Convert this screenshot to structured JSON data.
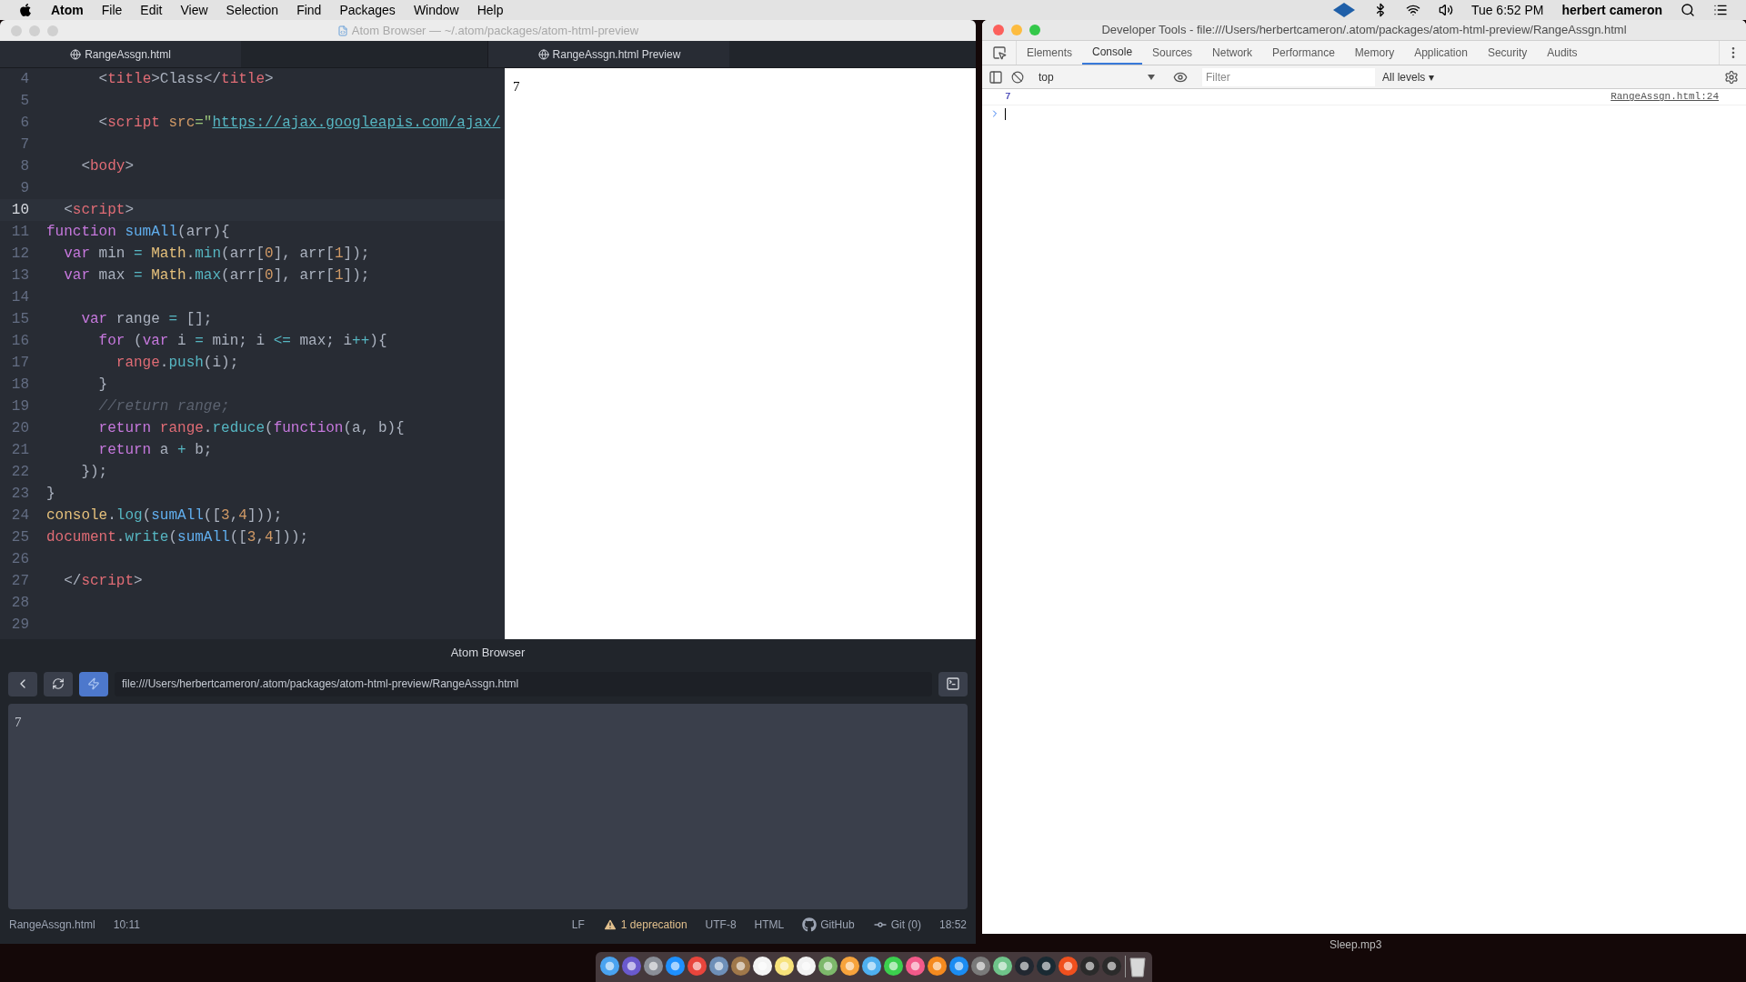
{
  "menu_bar": {
    "app": "Atom",
    "items": [
      "File",
      "Edit",
      "View",
      "Selection",
      "Find",
      "Packages",
      "Window",
      "Help"
    ],
    "clock": "Tue 6:52 PM",
    "user": "herbert cameron"
  },
  "atom_window": {
    "title": "Atom Browser — ~/.atom/packages/atom-html-preview",
    "tabs": [
      {
        "label": "RangeAssgn.html",
        "selected": true
      },
      {
        "label": "RangeAssgn.html Preview",
        "selected": true
      }
    ],
    "editor": {
      "lines": [
        {
          "number": "4",
          "current": false,
          "tokens": [
            {
              "text": "      <",
              "kind": "p"
            },
            {
              "text": "title",
              "kind": "tag"
            },
            {
              "text": ">Class</",
              "kind": "p"
            },
            {
              "text": "title",
              "kind": "tag"
            },
            {
              "text": ">",
              "kind": "p"
            }
          ]
        },
        {
          "number": "5",
          "current": false
        },
        {
          "number": "6",
          "current": false,
          "tokens": [
            {
              "text": "      <",
              "kind": "p"
            },
            {
              "text": "script",
              "kind": "tag"
            },
            {
              "text": " src",
              "kind": "attr"
            },
            {
              "text": "=\"",
              "kind": "str"
            },
            {
              "text": "https://ajax.googleapis.com/ajax/",
              "kind": "link"
            }
          ]
        },
        {
          "number": "7",
          "current": false
        },
        {
          "number": "8",
          "current": false,
          "tokens": [
            {
              "text": "    <",
              "kind": "p"
            },
            {
              "text": "body",
              "kind": "tag"
            },
            {
              "text": ">",
              "kind": "p"
            }
          ]
        },
        {
          "number": "9",
          "current": false
        },
        {
          "number": "10",
          "current": true,
          "tokens": [
            {
              "text": "  <",
              "kind": "p"
            },
            {
              "text": "script",
              "kind": "tag"
            },
            {
              "text": ">",
              "kind": "p"
            }
          ]
        },
        {
          "number": "11",
          "current": false,
          "tokens": [
            {
              "text": "function",
              "kind": "kw"
            },
            {
              "text": " sumAll",
              "kind": "fn"
            },
            {
              "text": "(arr){",
              "kind": "p"
            }
          ]
        },
        {
          "number": "12",
          "current": false,
          "tokens": [
            {
              "text": "  var",
              "kind": "kw"
            },
            {
              "text": " min ",
              "kind": "p"
            },
            {
              "text": "=",
              "kind": "op"
            },
            {
              "text": " Math",
              "kind": "obj"
            },
            {
              "text": ".",
              "kind": "p"
            },
            {
              "text": "min",
              "kind": "method"
            },
            {
              "text": "(arr[",
              "kind": "p"
            },
            {
              "text": "0",
              "kind": "num"
            },
            {
              "text": "], arr[",
              "kind": "p"
            },
            {
              "text": "1",
              "kind": "num"
            },
            {
              "text": "]);",
              "kind": "p"
            }
          ]
        },
        {
          "number": "13",
          "current": false,
          "tokens": [
            {
              "text": "  var",
              "kind": "kw"
            },
            {
              "text": " max ",
              "kind": "p"
            },
            {
              "text": "=",
              "kind": "op"
            },
            {
              "text": " Math",
              "kind": "obj"
            },
            {
              "text": ".",
              "kind": "p"
            },
            {
              "text": "max",
              "kind": "method"
            },
            {
              "text": "(arr[",
              "kind": "p"
            },
            {
              "text": "0",
              "kind": "num"
            },
            {
              "text": "], arr[",
              "kind": "p"
            },
            {
              "text": "1",
              "kind": "num"
            },
            {
              "text": "]);",
              "kind": "p"
            }
          ]
        },
        {
          "number": "14",
          "current": false
        },
        {
          "number": "15",
          "current": false,
          "tokens": [
            {
              "text": "    var",
              "kind": "kw"
            },
            {
              "text": " range ",
              "kind": "p"
            },
            {
              "text": "=",
              "kind": "op"
            },
            {
              "text": " [];",
              "kind": "p"
            }
          ]
        },
        {
          "number": "16",
          "current": false,
          "tokens": [
            {
              "text": "      for",
              "kind": "kw"
            },
            {
              "text": " (",
              "kind": "p"
            },
            {
              "text": "var",
              "kind": "kw"
            },
            {
              "text": " i ",
              "kind": "p"
            },
            {
              "text": "=",
              "kind": "op"
            },
            {
              "text": " min; i ",
              "kind": "p"
            },
            {
              "text": "<=",
              "kind": "op"
            },
            {
              "text": " max; i",
              "kind": "p"
            },
            {
              "text": "++",
              "kind": "op"
            },
            {
              "text": "){",
              "kind": "p"
            }
          ]
        },
        {
          "number": "17",
          "current": false,
          "tokens": [
            {
              "text": "        range",
              "kind": "var"
            },
            {
              "text": ".",
              "kind": "p"
            },
            {
              "text": "push",
              "kind": "method"
            },
            {
              "text": "(i);",
              "kind": "p"
            }
          ]
        },
        {
          "number": "18",
          "current": false,
          "tokens": [
            {
              "text": "      }",
              "kind": "p"
            }
          ]
        },
        {
          "number": "19",
          "current": false,
          "tokens": [
            {
              "text": "      //return range;",
              "kind": "comment"
            }
          ]
        },
        {
          "number": "20",
          "current": false,
          "tokens": [
            {
              "text": "      return",
              "kind": "kw"
            },
            {
              "text": " range",
              "kind": "var"
            },
            {
              "text": ".",
              "kind": "p"
            },
            {
              "text": "reduce",
              "kind": "method"
            },
            {
              "text": "(",
              "kind": "p"
            },
            {
              "text": "function",
              "kind": "kw"
            },
            {
              "text": "(a, b){",
              "kind": "p"
            }
          ]
        },
        {
          "number": "21",
          "current": false,
          "tokens": [
            {
              "text": "      return",
              "kind": "kw"
            },
            {
              "text": " a ",
              "kind": "p"
            },
            {
              "text": "+",
              "kind": "op"
            },
            {
              "text": " b;",
              "kind": "p"
            }
          ]
        },
        {
          "number": "22",
          "current": false,
          "tokens": [
            {
              "text": "    });",
              "kind": "p"
            }
          ]
        },
        {
          "number": "23",
          "current": false,
          "tokens": [
            {
              "text": "}",
              "kind": "p"
            }
          ]
        },
        {
          "number": "24",
          "current": false,
          "tokens": [
            {
              "text": "console",
              "kind": "obj"
            },
            {
              "text": ".",
              "kind": "p"
            },
            {
              "text": "log",
              "kind": "method"
            },
            {
              "text": "(",
              "kind": "p"
            },
            {
              "text": "sumAll",
              "kind": "fn"
            },
            {
              "text": "([",
              "kind": "p"
            },
            {
              "text": "3",
              "kind": "num"
            },
            {
              "text": ",",
              "kind": "p"
            },
            {
              "text": "4",
              "kind": "num"
            },
            {
              "text": "]));",
              "kind": "p"
            }
          ]
        },
        {
          "number": "25",
          "current": false,
          "tokens": [
            {
              "text": "document",
              "kind": "var"
            },
            {
              "text": ".",
              "kind": "p"
            },
            {
              "text": "write",
              "kind": "method"
            },
            {
              "text": "(",
              "kind": "p"
            },
            {
              "text": "sumAll",
              "kind": "fn"
            },
            {
              "text": "([",
              "kind": "p"
            },
            {
              "text": "3",
              "kind": "num"
            },
            {
              "text": ",",
              "kind": "p"
            },
            {
              "text": "4",
              "kind": "num"
            },
            {
              "text": "]));",
              "kind": "p"
            }
          ]
        },
        {
          "number": "26",
          "current": false
        },
        {
          "number": "27",
          "current": false,
          "tokens": [
            {
              "text": "  </",
              "kind": "p"
            },
            {
              "text": "script",
              "kind": "tag"
            },
            {
              "text": ">",
              "kind": "p"
            }
          ]
        },
        {
          "number": "28",
          "current": false
        },
        {
          "number": "29",
          "current": false
        }
      ]
    },
    "preview": {
      "text": "7"
    },
    "browser": {
      "title": "Atom Browser",
      "url": "file:///Users/herbertcameron/.atom/packages/atom-html-preview/RangeAssgn.html",
      "content": "7"
    },
    "status_bar": {
      "file": "RangeAssgn.html",
      "cursor": "10:11",
      "line_ending": "LF",
      "deprecation": "1 deprecation",
      "encoding": "UTF-8",
      "grammar": "HTML",
      "github": "GitHub",
      "git": "Git (0)",
      "time": "18:52"
    }
  },
  "devtools": {
    "title": "Developer Tools - file:///Users/herbertcameron/.atom/packages/atom-html-preview/RangeAssgn.html",
    "tabs": [
      {
        "label": "Elements",
        "selected": false
      },
      {
        "label": "Console",
        "selected": true
      },
      {
        "label": "Sources",
        "selected": false
      },
      {
        "label": "Network",
        "selected": false
      },
      {
        "label": "Performance",
        "selected": false
      },
      {
        "label": "Memory",
        "selected": false
      },
      {
        "label": "Application",
        "selected": false
      },
      {
        "label": "Security",
        "selected": false
      },
      {
        "label": "Audits",
        "selected": false
      }
    ],
    "context": "top",
    "filter_placeholder": "Filter",
    "levels": "All levels ▾",
    "console": [
      {
        "value": "7",
        "source": "RangeAssgn.html:24"
      }
    ]
  },
  "desktop": {
    "file_label": "Sleep.mp3"
  }
}
